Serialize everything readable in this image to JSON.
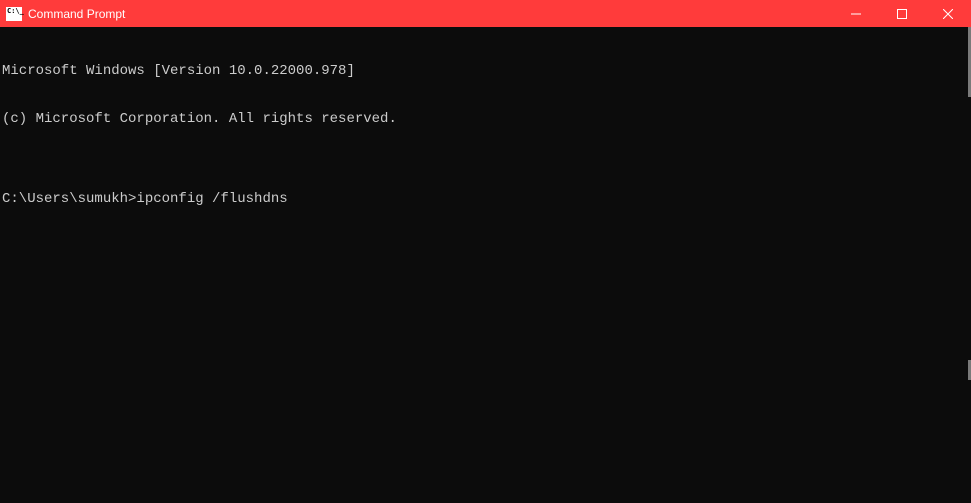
{
  "titlebar": {
    "title": "Command Prompt"
  },
  "terminal": {
    "line1": "Microsoft Windows [Version 10.0.22000.978]",
    "line2": "(c) Microsoft Corporation. All rights reserved.",
    "blank": "",
    "prompt": "C:\\Users\\sumukh>",
    "command": "ipconfig /flushdns"
  }
}
